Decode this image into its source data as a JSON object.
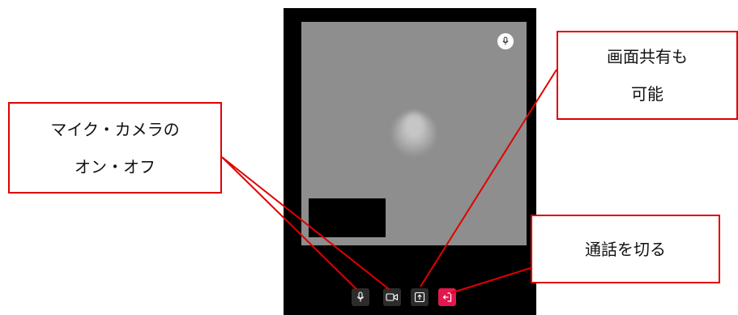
{
  "call_screen": {
    "controls": {
      "mic": "microphone-icon",
      "camera": "video-camera-icon",
      "share": "screen-share-icon",
      "leave": "leave-call-icon"
    },
    "colors": {
      "leave_button": "#e3184f",
      "control_button": "#2c2c2c",
      "video_background": "#8e8e8e"
    }
  },
  "annotations": {
    "mic_camera": {
      "line1": "マイク・カメラの",
      "line2": "オン・オフ"
    },
    "screen_share": {
      "line1": "画面共有も",
      "line2": "可能"
    },
    "hang_up": {
      "line1": "通話を切る"
    },
    "line_color": "#e00000"
  }
}
